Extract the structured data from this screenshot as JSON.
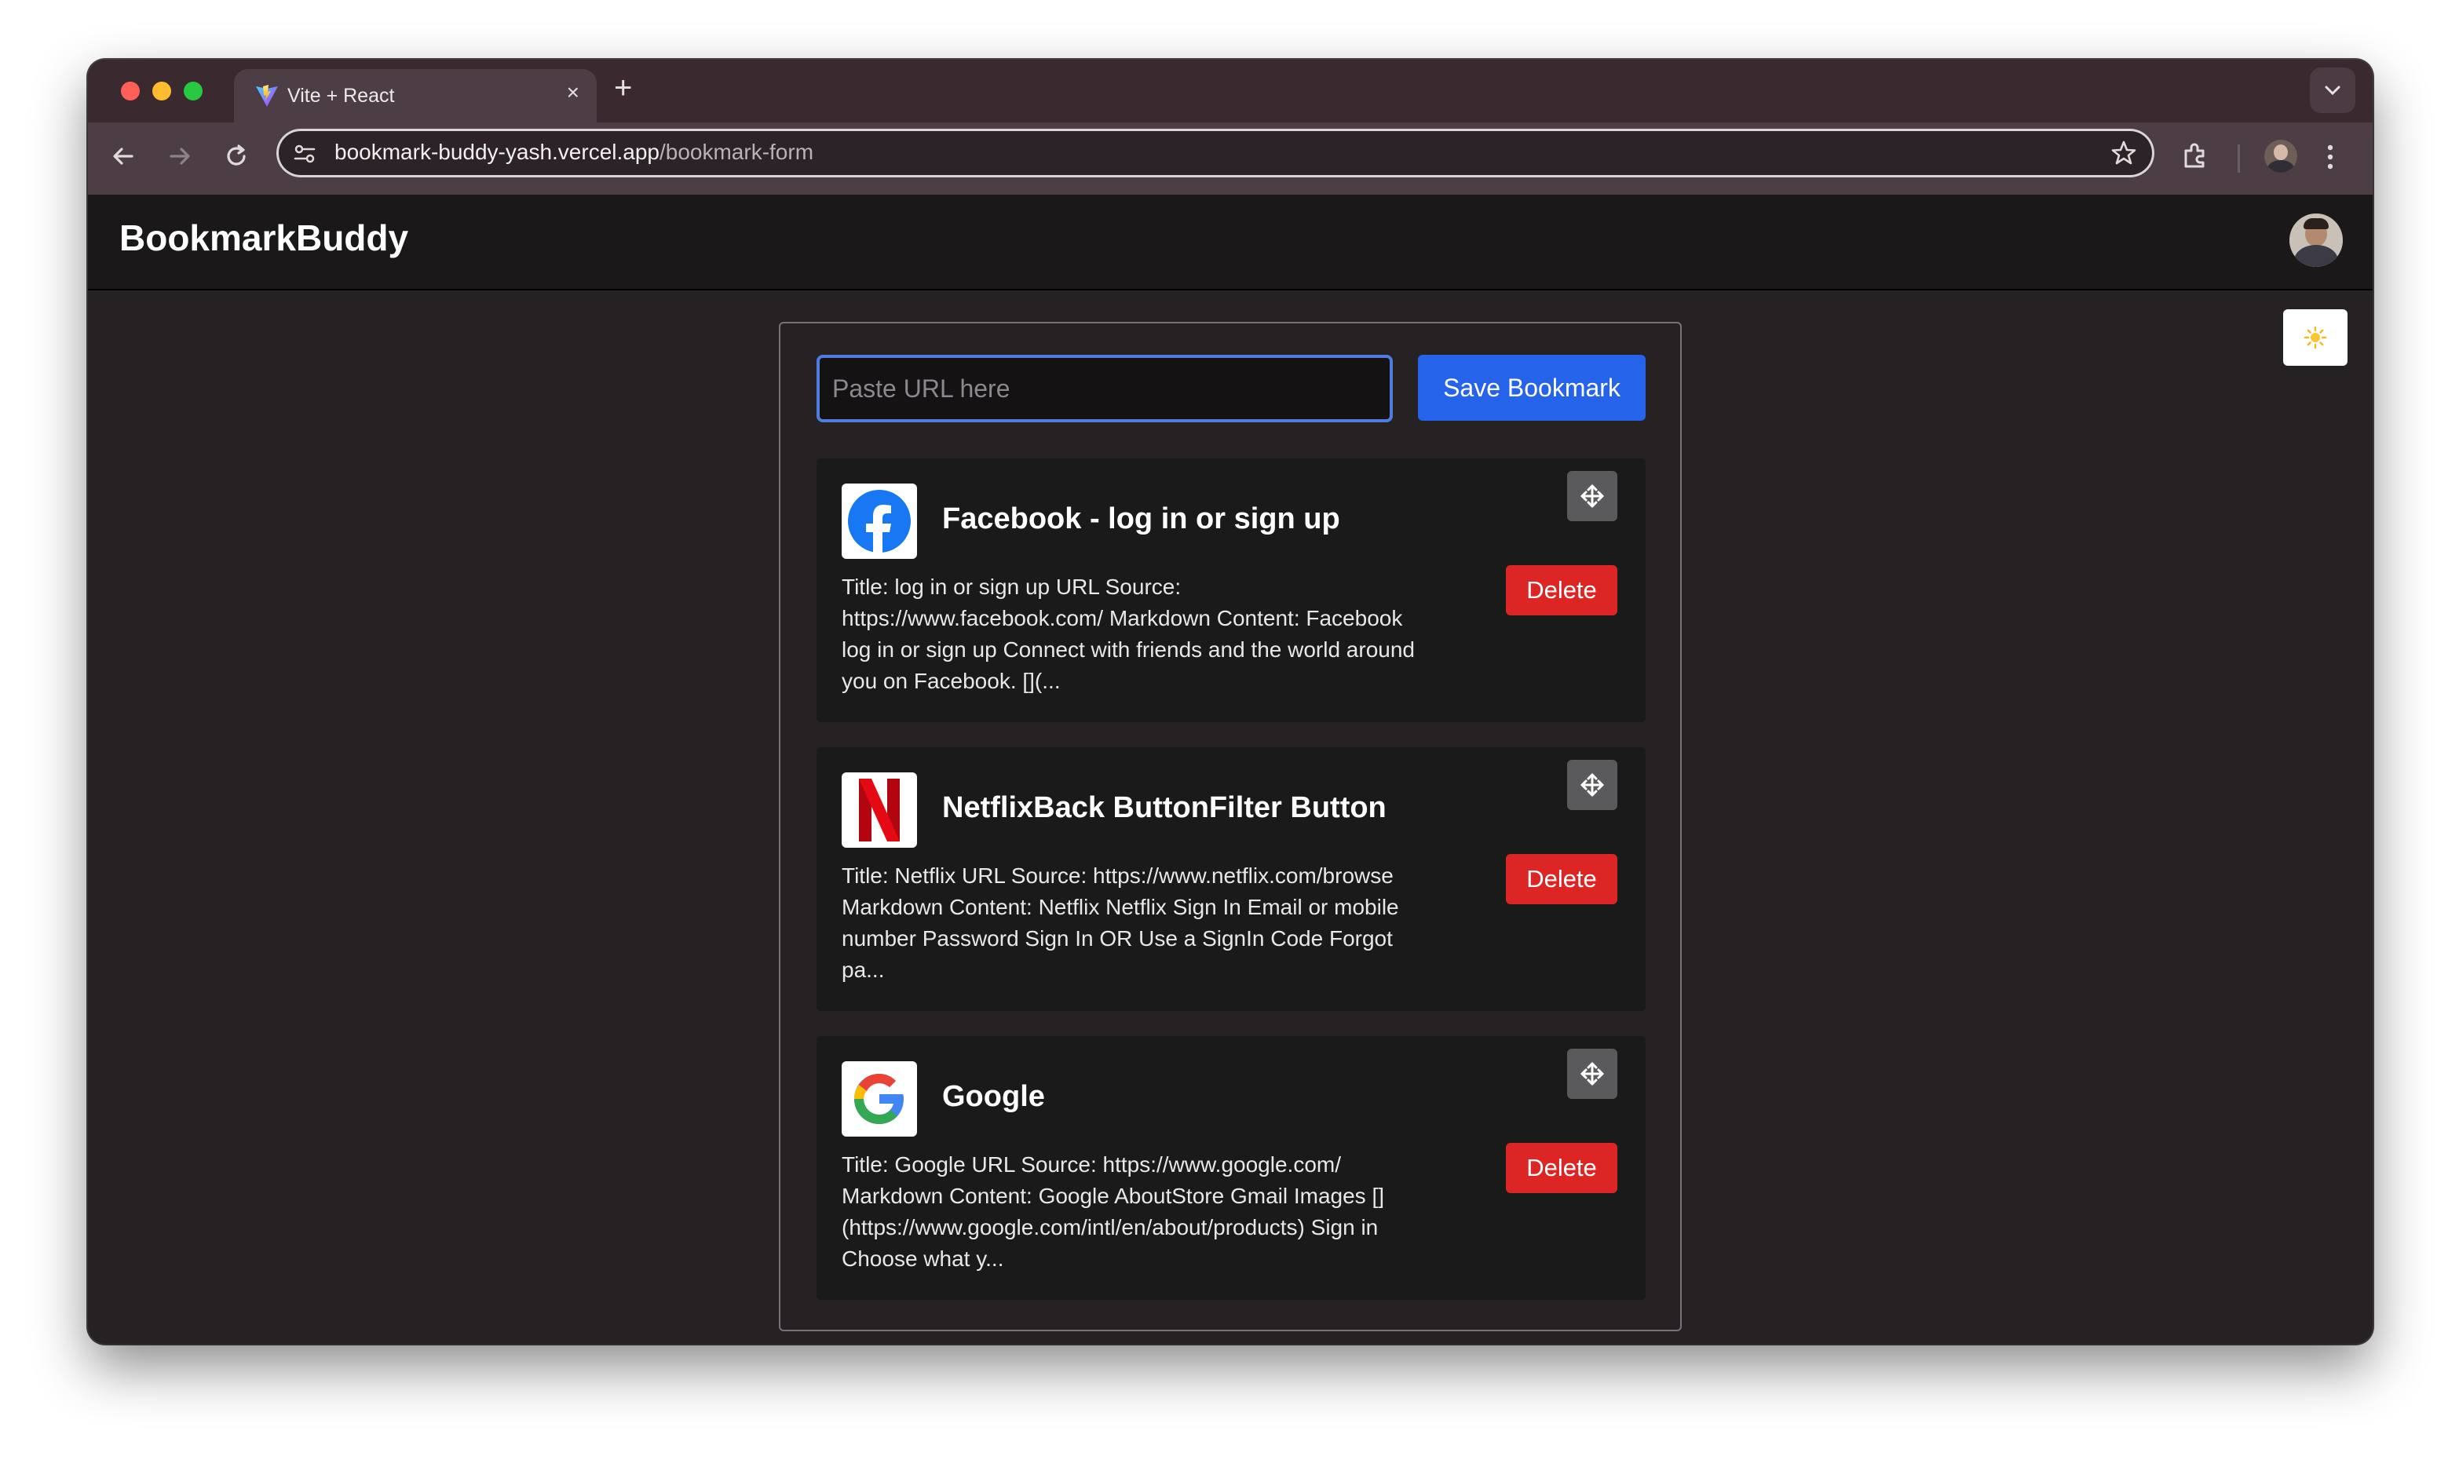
{
  "browser": {
    "tab": {
      "title": "Vite + React",
      "favicon": "vite-logo-icon"
    },
    "url": {
      "host": "bookmark-buddy-yash.vercel.app",
      "path": "/bookmark-form"
    }
  },
  "app": {
    "brand": "BookmarkBuddy",
    "theme_toggle_icon": "sun-icon",
    "form": {
      "url_placeholder": "Paste URL here",
      "url_value": "",
      "save_label": "Save Bookmark"
    },
    "bookmarks": [
      {
        "icon": "facebook-icon",
        "title": "Facebook - log in or sign up",
        "description": "Title: log in or sign up URL Source: https://www.facebook.com/ Markdown Content: Facebook log in or sign up Connect with friends and the world around you on Facebook. [](...",
        "delete_label": "Delete"
      },
      {
        "icon": "netflix-icon",
        "title": "NetflixBack ButtonFilter Button",
        "description": "Title: Netflix URL Source: https://www.netflix.com/browse Markdown Content: Netflix Netflix Sign In Email or mobile number Password Sign In OR Use a SignIn Code Forgot pa...",
        "delete_label": "Delete"
      },
      {
        "icon": "google-icon",
        "title": "Google",
        "description": "Title: Google URL Source: https://www.google.com/ Markdown Content: Google AboutStore Gmail Images [](https://www.google.com/intl/en/about/products) Sign in Choose what y...",
        "delete_label": "Delete"
      }
    ]
  },
  "colors": {
    "primary": "#2563eb",
    "danger": "#dc2626",
    "card_bg": "#1b1a1b",
    "page_bg": "#262224"
  }
}
